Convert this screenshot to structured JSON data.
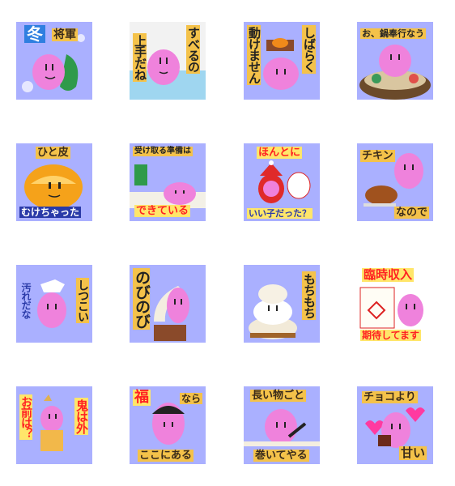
{
  "title": "",
  "stickers": [
    {
      "id": "s1",
      "texts": [
        "冬",
        "将軍"
      ]
    },
    {
      "id": "s2",
      "texts": [
        "すべるの",
        "上手だね"
      ]
    },
    {
      "id": "s3",
      "texts": [
        "しばらく",
        "動けません"
      ]
    },
    {
      "id": "s4",
      "texts": [
        "お、鍋奉行なう"
      ]
    },
    {
      "id": "s5",
      "texts": [
        "ひと皮",
        "むけちゃった"
      ]
    },
    {
      "id": "s6",
      "texts": [
        "受け取る準備は",
        "できている"
      ]
    },
    {
      "id": "s7",
      "texts": [
        "ほんとに",
        "いい子だった？"
      ]
    },
    {
      "id": "s8",
      "texts": [
        "チキン",
        "なので"
      ]
    },
    {
      "id": "s9",
      "texts": [
        "しつこい",
        "汚れだな"
      ]
    },
    {
      "id": "s10",
      "texts": [
        "のびのび"
      ]
    },
    {
      "id": "s11",
      "texts": [
        "もちもち"
      ]
    },
    {
      "id": "s12",
      "texts": [
        "臨時収入",
        "期待してます"
      ]
    },
    {
      "id": "s13",
      "texts": [
        "鬼は外",
        "お前は？"
      ]
    },
    {
      "id": "s14",
      "texts": [
        "福",
        "なら",
        "ここにある"
      ]
    },
    {
      "id": "s15",
      "texts": [
        "長い物ごと",
        "巻いてやる"
      ]
    },
    {
      "id": "s16",
      "texts": [
        "チョコより",
        "甘い"
      ]
    }
  ],
  "colors": {
    "tile_bg": "#aab0ff",
    "character": "#ef82dc",
    "caption_yellow": "#f4c24a",
    "caption_red": "#ff2222",
    "caption_blue": "#2a3aa8"
  }
}
